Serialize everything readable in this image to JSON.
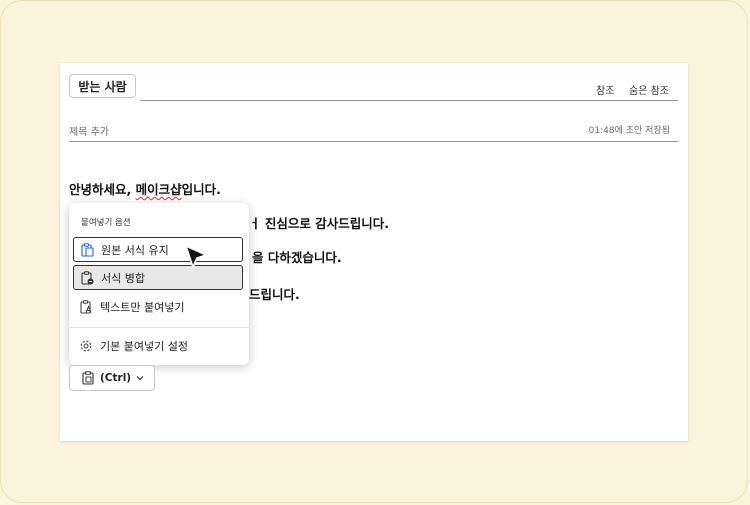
{
  "header": {
    "to_button": "받는 사람",
    "cc": "참조",
    "bcc": "숨은 참조",
    "subject_placeholder": "제목 추가",
    "saved_status": "01:48에 초안 저장됨"
  },
  "body": {
    "greeting_prefix": "안녕하세요, ",
    "greeting_name": "메이크샵",
    "greeting_suffix": "입니다.",
    "line2": "ㅓ 진심으로 감사드립니다.",
    "line3": "을 다하겠습니다.",
    "line4": "드립니다."
  },
  "paste_menu": {
    "title": "붙여넣기 옵션",
    "items": [
      {
        "label": "원본 서식 유지",
        "icon": "clipboard-keep-icon"
      },
      {
        "label": "서식 병합",
        "icon": "clipboard-merge-icon"
      },
      {
        "label": "텍스트만 붙여넣기",
        "icon": "clipboard-text-icon"
      },
      {
        "label": "기본 붙여넣기 설정",
        "icon": "gear-icon"
      }
    ]
  },
  "paste_options_button": {
    "label": "(Ctrl)",
    "icon": "clipboard-icon",
    "chevron": "chevron-down-icon"
  }
}
